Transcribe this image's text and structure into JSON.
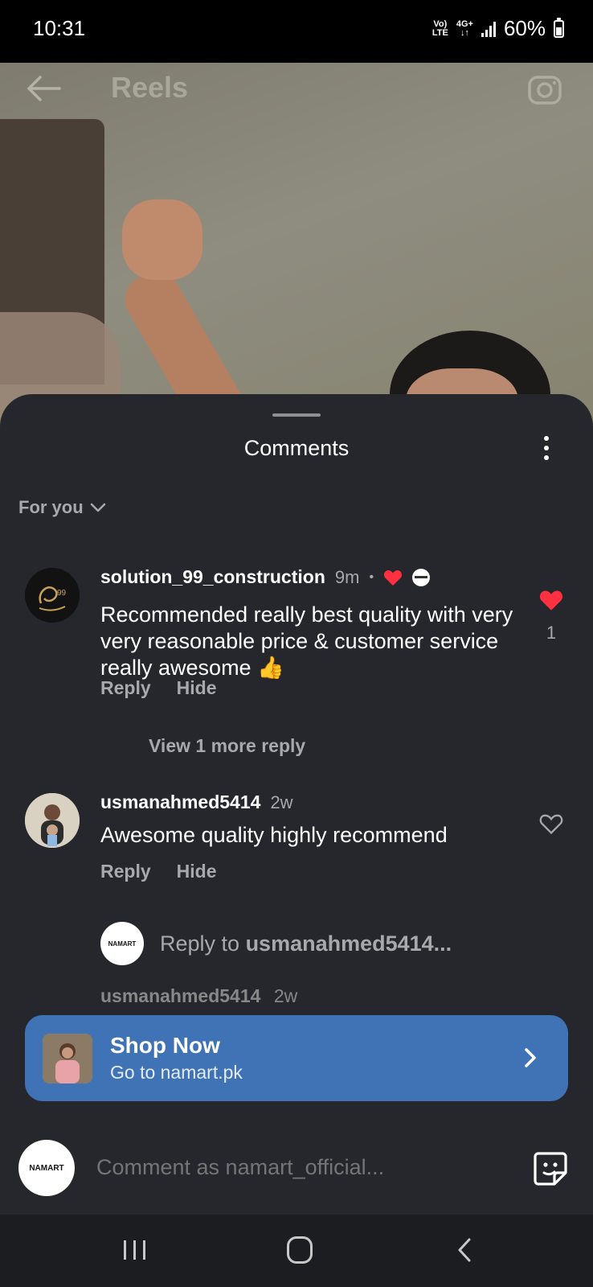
{
  "status_bar": {
    "time": "10:31",
    "network_top": "Vo)",
    "network_bottom": "LTE",
    "network_type_top": "4G+",
    "network_type_bottom": "↓↑",
    "battery": "60%"
  },
  "header": {
    "title": "Reels",
    "back_icon": "back-arrow-icon",
    "camera_icon": "camera-icon"
  },
  "sheet": {
    "title": "Comments",
    "filter_label": "For you"
  },
  "comments": [
    {
      "username": "solution_99_construction",
      "time": "9m",
      "text": "Recommended really best quality with very very reasonable price & customer service really awesome 👍",
      "reply_label": "Reply",
      "hide_label": "Hide",
      "view_more": "View 1 more reply",
      "likes": "1",
      "liked": true,
      "creator_liked": true
    },
    {
      "username": "usmanahmed5414",
      "time": "2w",
      "text": "Awesome quality highly recommend",
      "reply_label": "Reply",
      "hide_label": "Hide",
      "liked": false
    }
  ],
  "reply_prompt": {
    "prefix": "Reply to ",
    "username": "usmanahmed5414...",
    "avatar_text": "NAMART"
  },
  "peek_username": "usmanahmed5414",
  "peek_time": "2w",
  "shop": {
    "title": "Shop Now",
    "subtitle": "Go to namart.pk"
  },
  "composer": {
    "placeholder": "Comment as namart_official...",
    "avatar_text": "NAMART"
  },
  "colors": {
    "sheet_bg": "#25272c",
    "accent_red": "#ff3040",
    "shop_blue": "#3f73b6"
  }
}
